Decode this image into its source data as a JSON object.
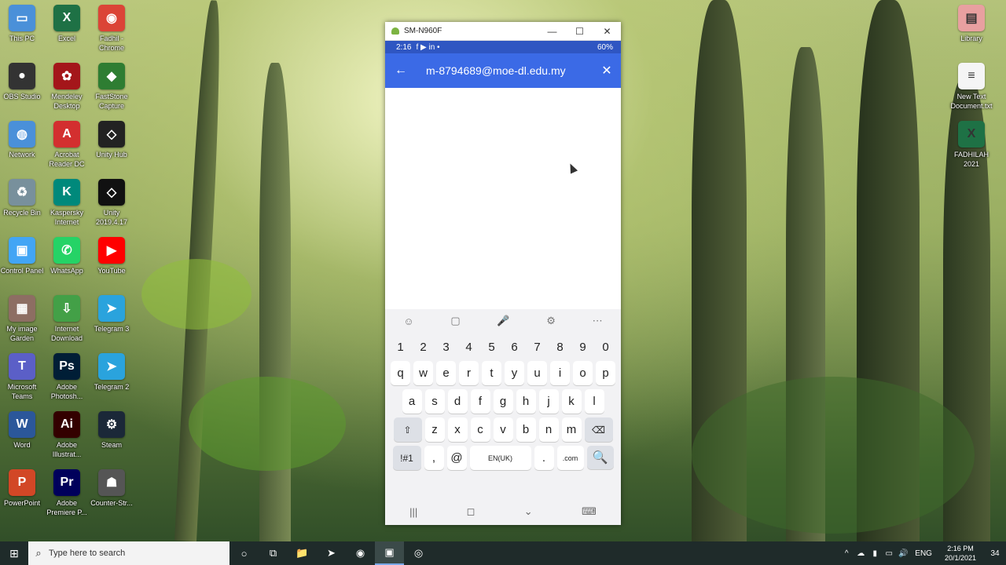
{
  "desktop": {
    "left_icons": [
      {
        "label": "This PC",
        "glyph": "▭",
        "color": "#4a90d9"
      },
      {
        "label": "Excel",
        "glyph": "X",
        "color": "#1e7145"
      },
      {
        "label": "Fadhil - Chrome",
        "glyph": "◉",
        "color": "#db4437"
      },
      {
        "label": "OBS Studio",
        "glyph": "●",
        "color": "#333"
      },
      {
        "label": "Mendeley Desktop",
        "glyph": "✿",
        "color": "#a4161a"
      },
      {
        "label": "FastStone Capture",
        "glyph": "◆",
        "color": "#2e7d32"
      },
      {
        "label": "Network",
        "glyph": "◍",
        "color": "#4a90d9"
      },
      {
        "label": "Acrobat Reader DC",
        "glyph": "A",
        "color": "#d32f2f"
      },
      {
        "label": "Unity Hub",
        "glyph": "◇",
        "color": "#222"
      },
      {
        "label": "Recycle Bin",
        "glyph": "♻",
        "color": "#78909c"
      },
      {
        "label": "Kaspersky Internet",
        "glyph": "K",
        "color": "#00897b"
      },
      {
        "label": "Unity 2019.4.17",
        "glyph": "◇",
        "color": "#111"
      },
      {
        "label": "Control Panel",
        "glyph": "▣",
        "color": "#42a5f5"
      },
      {
        "label": "WhatsApp",
        "glyph": "✆",
        "color": "#25d366"
      },
      {
        "label": "YouTube",
        "glyph": "▶",
        "color": "#ff0000"
      },
      {
        "label": "My image Garden",
        "glyph": "▦",
        "color": "#8d6e63"
      },
      {
        "label": "Internet Download",
        "glyph": "⇩",
        "color": "#43a047"
      },
      {
        "label": "Telegram 3",
        "glyph": "➤",
        "color": "#2aa3dd"
      },
      {
        "label": "Microsoft Teams",
        "glyph": "T",
        "color": "#5b5fc7"
      },
      {
        "label": "Adobe Photosh...",
        "glyph": "Ps",
        "color": "#001e36"
      },
      {
        "label": "Telegram 2",
        "glyph": "➤",
        "color": "#2aa3dd"
      },
      {
        "label": "Word",
        "glyph": "W",
        "color": "#2b579a"
      },
      {
        "label": "Adobe Illustrat...",
        "glyph": "Ai",
        "color": "#330000"
      },
      {
        "label": "Steam",
        "glyph": "⚙",
        "color": "#1b2838"
      },
      {
        "label": "PowerPoint",
        "glyph": "P",
        "color": "#d24726"
      },
      {
        "label": "Adobe Premiere P...",
        "glyph": "Pr",
        "color": "#00005b"
      },
      {
        "label": "Counter-Str...",
        "glyph": "☗",
        "color": "#555"
      }
    ],
    "right_icons": [
      {
        "label": "Library",
        "glyph": "▤",
        "color": "#e8a0a0"
      },
      {
        "label": "New Text Document.txt",
        "glyph": "≡",
        "color": "#f5f5f5"
      },
      {
        "label": "FADHILAH 2021",
        "glyph": "X",
        "color": "#1e7145"
      }
    ]
  },
  "window": {
    "title": "SM-N960F",
    "minimize": "—",
    "maximize": "☐",
    "close": "✕"
  },
  "phone": {
    "status_time": "2:16",
    "status_left_icons": "f ▶ in •",
    "status_right": "60%",
    "appbar_title": "m-8794689@moe-dl.edu.my",
    "back_icon": "←",
    "close_icon": "✕"
  },
  "keyboard": {
    "toolbar": [
      "☺",
      "▢",
      "🎤",
      "⚙",
      "⋯"
    ],
    "numbers": [
      "1",
      "2",
      "3",
      "4",
      "5",
      "6",
      "7",
      "8",
      "9",
      "0"
    ],
    "row1": [
      "q",
      "w",
      "e",
      "r",
      "t",
      "y",
      "u",
      "i",
      "o",
      "p"
    ],
    "row2": [
      "a",
      "s",
      "d",
      "f",
      "g",
      "h",
      "j",
      "k",
      "l"
    ],
    "row3": [
      "z",
      "x",
      "c",
      "v",
      "b",
      "n",
      "m"
    ],
    "shift": "⇧",
    "backspace": "⌫",
    "symbols": "!#1",
    "comma": ",",
    "at": "@",
    "space": "EN(UK)",
    "period": ".",
    "dotcom": ".com",
    "search": "🔍",
    "nav": [
      "|||",
      "◻",
      "⌄",
      "⌨"
    ]
  },
  "taskbar": {
    "search_placeholder": "Type here to search",
    "start_icon": "⊞",
    "apps": [
      "○",
      "⧉",
      "📁",
      "➤",
      "◉",
      "▣",
      "◎"
    ],
    "tray_icons": [
      "^",
      "☁",
      "▮",
      "▭",
      "🔊"
    ],
    "lang": "ENG",
    "time": "2:16 PM",
    "date": "20/1/2021",
    "notif": "34"
  }
}
